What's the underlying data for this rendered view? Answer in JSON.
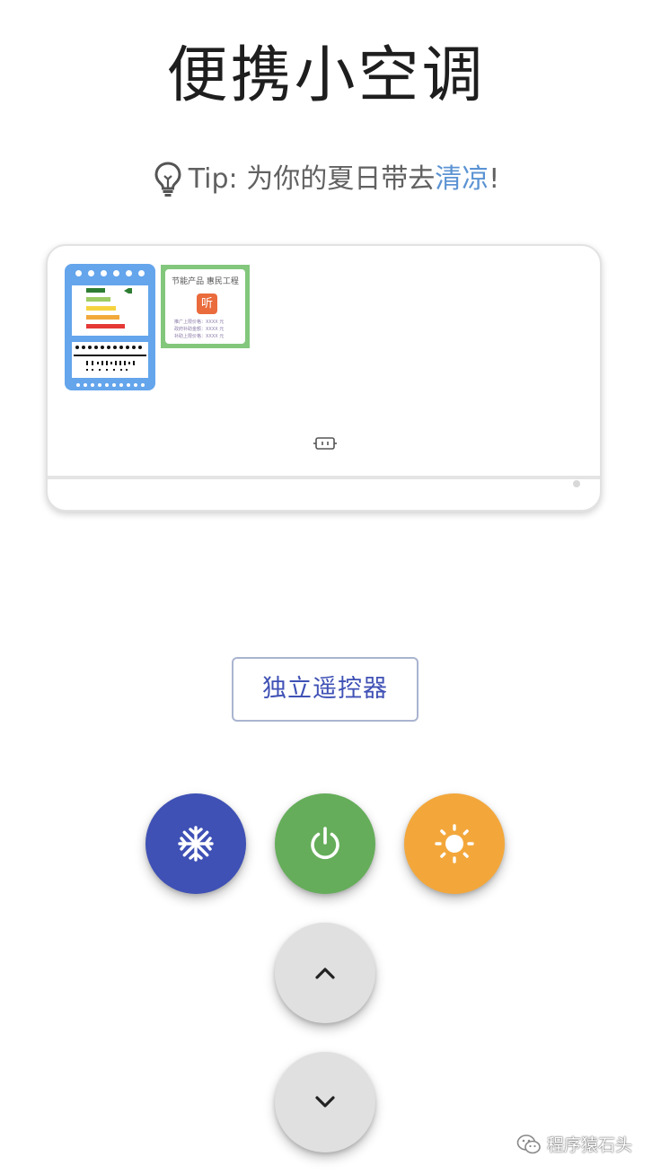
{
  "page": {
    "title": "便携小空调",
    "tip_prefix": "Tip: 为你的夏日带去",
    "tip_highlight": "清凉",
    "tip_suffix": "!",
    "highlight_color": "#5b93d3"
  },
  "air_conditioner": {
    "energy_label": {
      "icon": "energy-efficiency-label",
      "bar_colors": [
        "#2e7d32",
        "#9ccc65",
        "#f5d33f",
        "#f2a93b",
        "#e53935"
      ]
    },
    "subsidy_label": {
      "header": "节能产品 惠民工程",
      "logo_text": "听",
      "fine_print": [
        "推广上限价格：XXXX 元",
        "政府补助金额：XXXX 元",
        "补助上限价格：XXXX 元"
      ]
    },
    "status_icon": "ac-status-icon"
  },
  "controls": {
    "remote_label": "独立遥控器",
    "cool": {
      "icon": "snowflake-icon",
      "color": "#3f51b5"
    },
    "power": {
      "icon": "power-icon",
      "color": "#65ad5a"
    },
    "heat": {
      "icon": "sun-icon",
      "color": "#f3a73b"
    },
    "temp_up": {
      "icon": "chevron-up-icon"
    },
    "temp_down": {
      "icon": "chevron-down-icon"
    }
  },
  "watermark": {
    "text": "程序猿石头",
    "icon": "wechat-icon"
  }
}
